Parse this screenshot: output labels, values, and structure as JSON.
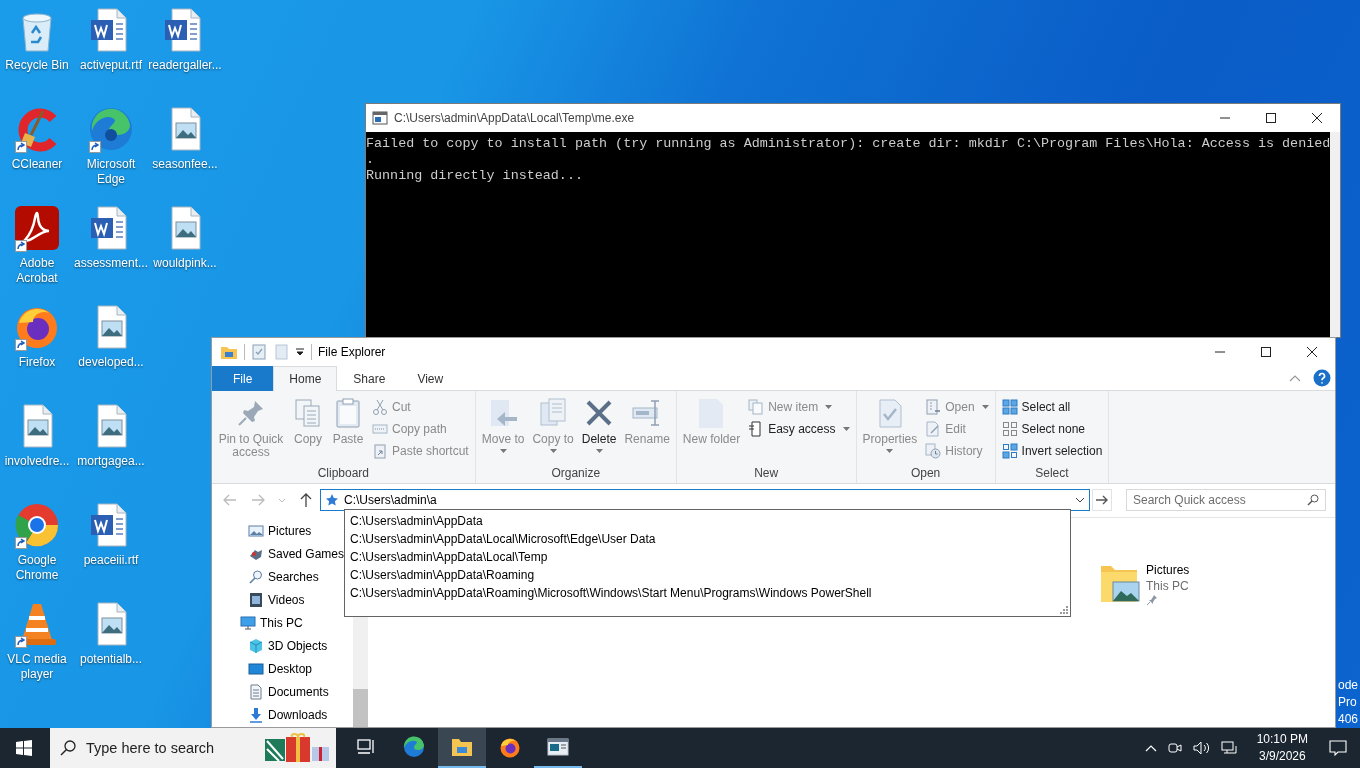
{
  "desktop": {
    "rows": [
      [
        {
          "label": "Recycle Bin",
          "kind": "recycle",
          "shortcut": false
        },
        {
          "label": "activeput.rtf",
          "kind": "word",
          "shortcut": false
        },
        {
          "label": "readergaller...",
          "kind": "word",
          "shortcut": false
        }
      ],
      [
        {
          "label": "CCleaner",
          "kind": "ccleaner",
          "shortcut": true
        },
        {
          "label": "Microsoft Edge",
          "kind": "edge",
          "shortcut": true
        },
        {
          "label": "seasonfee...",
          "kind": "image",
          "shortcut": false
        }
      ],
      [
        {
          "label": "Adobe Acrobat",
          "kind": "acrobat",
          "shortcut": true
        },
        {
          "label": "assessment...",
          "kind": "word",
          "shortcut": false
        },
        {
          "label": "wouldpink...",
          "kind": "image",
          "shortcut": false
        }
      ],
      [
        {
          "label": "Firefox",
          "kind": "firefox",
          "shortcut": true
        },
        {
          "label": "developed...",
          "kind": "image",
          "shortcut": false
        }
      ],
      [
        {
          "label": "involvedre...",
          "kind": "image",
          "shortcut": false
        },
        {
          "label": "mortgagea...",
          "kind": "image",
          "shortcut": false
        }
      ],
      [
        {
          "label": "Google Chrome",
          "kind": "chrome",
          "shortcut": true
        },
        {
          "label": "peaceiii.rtf",
          "kind": "word",
          "shortcut": false
        }
      ],
      [
        {
          "label": "VLC media player",
          "kind": "vlc",
          "shortcut": true
        },
        {
          "label": "potentialb...",
          "kind": "image",
          "shortcut": false
        }
      ]
    ],
    "edge_text": [
      "ode",
      "Pro",
      "406"
    ]
  },
  "console": {
    "title": "C:\\Users\\admin\\AppData\\Local\\Temp\\me.exe",
    "lines": [
      "Failed to copy to install path (try running as Administrator): create dir: mkdir C:\\Program Files\\Hola: Access is denied",
      ".",
      "Running directly instead..."
    ]
  },
  "explorer": {
    "title": "File Explorer",
    "tabs": [
      {
        "label": "File",
        "kind": "file",
        "selected": false
      },
      {
        "label": "Home",
        "kind": "tab",
        "selected": true
      },
      {
        "label": "Share",
        "kind": "tab",
        "selected": false
      },
      {
        "label": "View",
        "kind": "tab",
        "selected": false
      }
    ],
    "ribbon": [
      {
        "label": "Clipboard",
        "buttons": [
          {
            "label": "Pin to Quick access",
            "kind": "large",
            "disabled": true,
            "menu": false
          },
          {
            "label": "Copy",
            "kind": "large",
            "disabled": true,
            "menu": false
          },
          {
            "label": "Paste",
            "kind": "large",
            "disabled": true,
            "menu": false
          },
          {
            "label": "Cut",
            "kind": "small",
            "disabled": true,
            "menu": false
          },
          {
            "label": "Copy path",
            "kind": "small",
            "disabled": true,
            "menu": false
          },
          {
            "label": "Paste shortcut",
            "kind": "small",
            "disabled": true,
            "menu": false
          }
        ]
      },
      {
        "label": "Organize",
        "buttons": [
          {
            "label": "Move to",
            "kind": "large",
            "disabled": true,
            "menu": true
          },
          {
            "label": "Copy to",
            "kind": "large",
            "disabled": true,
            "menu": true
          },
          {
            "label": "Delete",
            "kind": "large",
            "disabled": false,
            "menu": true
          },
          {
            "label": "Rename",
            "kind": "large",
            "disabled": true,
            "menu": false
          }
        ]
      },
      {
        "label": "New",
        "buttons": [
          {
            "label": "New folder",
            "kind": "large",
            "disabled": true,
            "menu": false
          },
          {
            "label": "New item",
            "kind": "small",
            "disabled": true,
            "menu": true
          },
          {
            "label": "Easy access",
            "kind": "small",
            "disabled": false,
            "menu": true
          }
        ]
      },
      {
        "label": "Open",
        "buttons": [
          {
            "label": "Properties",
            "kind": "large",
            "disabled": true,
            "menu": true
          },
          {
            "label": "Open",
            "kind": "small",
            "disabled": true,
            "menu": true
          },
          {
            "label": "Edit",
            "kind": "small",
            "disabled": true,
            "menu": false
          },
          {
            "label": "History",
            "kind": "small",
            "disabled": true,
            "menu": false
          }
        ]
      },
      {
        "label": "Select",
        "buttons": [
          {
            "label": "Select all",
            "kind": "small",
            "disabled": false,
            "menu": false
          },
          {
            "label": "Select none",
            "kind": "small",
            "disabled": false,
            "menu": false
          },
          {
            "label": "Invert selection",
            "kind": "small",
            "disabled": false,
            "menu": false
          }
        ]
      }
    ],
    "address": {
      "value": "C:\\Users\\admin\\a"
    },
    "search": {
      "placeholder": "Search Quick access"
    },
    "suggestions": [
      "C:\\Users\\admin\\AppData",
      "C:\\Users\\admin\\AppData\\Local\\Microsoft\\Edge\\User Data",
      "C:\\Users\\admin\\AppData\\Local\\Temp",
      "C:\\Users\\admin\\AppData\\Roaming",
      "C:\\Users\\admin\\AppData\\Roaming\\Microsoft\\Windows\\Start Menu\\Programs\\Windows PowerShell"
    ],
    "nav": {
      "continued": [
        {
          "label": "Pictures",
          "kind": "pictures"
        },
        {
          "label": "Saved Games",
          "kind": "games"
        },
        {
          "label": "Searches",
          "kind": "search"
        },
        {
          "label": "Videos",
          "kind": "videos"
        }
      ],
      "tree": [
        {
          "label": "This PC",
          "kind": "pc",
          "children": [
            {
              "label": "3D Objects",
              "kind": "cube"
            },
            {
              "label": "Desktop",
              "kind": "desktop"
            },
            {
              "label": "Documents",
              "kind": "documents"
            },
            {
              "label": "Downloads",
              "kind": "downloads"
            }
          ]
        }
      ]
    },
    "items": [
      {
        "name": "Pictures",
        "location": "This PC",
        "pinned": true
      }
    ]
  },
  "taskbar": {
    "search_placeholder": "Type here to search",
    "apps": [
      {
        "kind": "taskview",
        "selected": false,
        "running": false
      },
      {
        "kind": "edge",
        "selected": false,
        "running": false
      },
      {
        "kind": "explorer",
        "selected": true,
        "running": true
      },
      {
        "kind": "firefox",
        "selected": false,
        "running": false
      },
      {
        "kind": "console",
        "selected": false,
        "running": true
      }
    ],
    "time": "10:10 PM",
    "date": "3/9/2026"
  }
}
